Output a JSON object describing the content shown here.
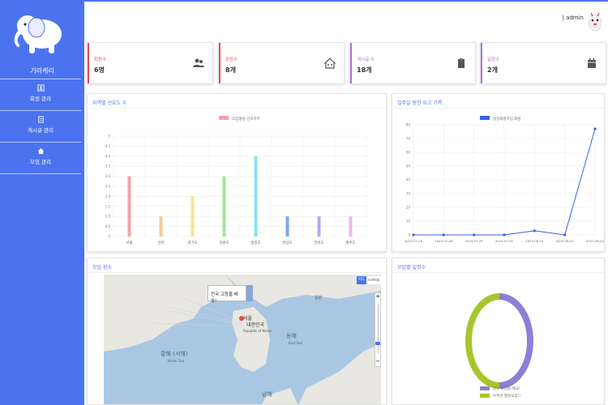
{
  "sidebar": {
    "brand": "기러케리",
    "items": [
      {
        "label": "회원 관리",
        "icon": "user-doc-icon"
      },
      {
        "label": "게시글 관리",
        "icon": "document-icon"
      },
      {
        "label": "모임 관리",
        "icon": "home-icon"
      }
    ]
  },
  "topbar": {
    "user": "admin"
  },
  "cards": [
    {
      "label": "회원수",
      "value": "6명",
      "color": "#e74a5c",
      "icon": "users-icon"
    },
    {
      "label": "모임수",
      "value": "8개",
      "color": "#e74a5c",
      "icon": "home-group-icon"
    },
    {
      "label": "게시글 수",
      "value": "18개",
      "color": "#b06fdc",
      "icon": "clipboard-icon"
    },
    {
      "label": "일정수",
      "value": "2개",
      "color": "#b06fdc",
      "icon": "calendar-icon"
    }
  ],
  "panels": {
    "region": "지역별 선호도 수",
    "daily": "일주일 동안 요고 기록",
    "map": "모임 장소",
    "donut": "모임별 일정수"
  },
  "map": {
    "popup": "전국 고등을 배포!",
    "type_map": "지도",
    "type_sat": "스카이뷰",
    "zoom_in": "+",
    "zoom_out": "−",
    "labels": [
      "서울",
      "대한민국",
      "Republic of Korea",
      "일본",
      "황해 (서해)",
      "Yellow Sea",
      "동해",
      "East Sea",
      "남해"
    ]
  },
  "chart_data": [
    {
      "type": "bar",
      "legend": "모임생성 선호지역",
      "categories": [
        "서울",
        "인천",
        "경기도",
        "강원도",
        "충청도",
        "경상도",
        "전라도",
        "제주도"
      ],
      "values": [
        3,
        1,
        2,
        3,
        4,
        1,
        1,
        1
      ],
      "colors": [
        "#f4a3a8",
        "#f7c99a",
        "#f8e48f",
        "#a6e2a0",
        "#86e3ef",
        "#7ea8f2",
        "#b9a5f2",
        "#f0b6f0"
      ],
      "ylim": [
        0,
        5
      ],
      "yticks": [
        "0",
        "0.5",
        "1.0",
        "1.5",
        "2.0",
        "2.5",
        "3.0",
        "3.5",
        "4.0",
        "4.5",
        "5"
      ]
    },
    {
      "type": "line",
      "legend": "일일회원가입 회원",
      "x": [
        "2023-07-26",
        "2023-07-28",
        "2023-07-29",
        "2023-07-31",
        "2023-08-01",
        "2023-08-02",
        "2023-08-03"
      ],
      "values": [
        0,
        0,
        0,
        0,
        3,
        0,
        77
      ],
      "color": "#3d5fe0",
      "ylim": [
        0,
        80
      ],
      "yticks": [
        "0",
        "10",
        "20",
        "30",
        "40",
        "50",
        "60",
        "70",
        "80"
      ]
    },
    {
      "type": "pie",
      "legend": [
        "친구 모임을 해요!",
        "우주인 행성모임!!"
      ],
      "values": [
        1,
        1
      ],
      "colors": [
        "#8f7ed8",
        "#a7c62b"
      ]
    }
  ]
}
